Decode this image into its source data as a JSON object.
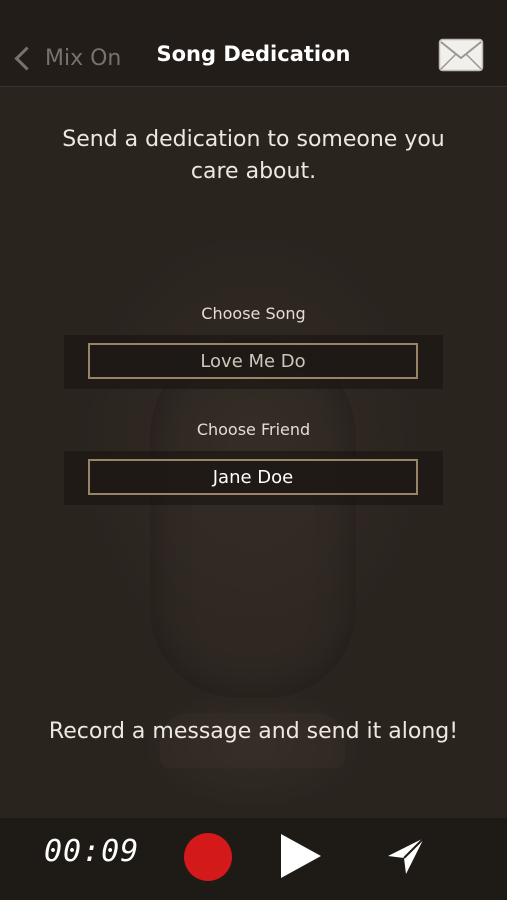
{
  "nav": {
    "back_label": "Mix On",
    "title": "Song Dedication",
    "mail_icon": "envelope-icon"
  },
  "intro_text": "Send a dedication to someone you care about.",
  "song": {
    "label": "Choose Song",
    "value": "Love Me Do"
  },
  "friend": {
    "label": "Choose Friend",
    "value": "Jane Doe"
  },
  "record_prompt": "Record a message and send it along!",
  "controls": {
    "timer": "00:09",
    "record_icon": "record-icon",
    "play_icon": "play-icon",
    "send_icon": "send-icon"
  },
  "colors": {
    "background": "#2b2520",
    "record": "#d4191b",
    "field_border": "#9a8468"
  }
}
